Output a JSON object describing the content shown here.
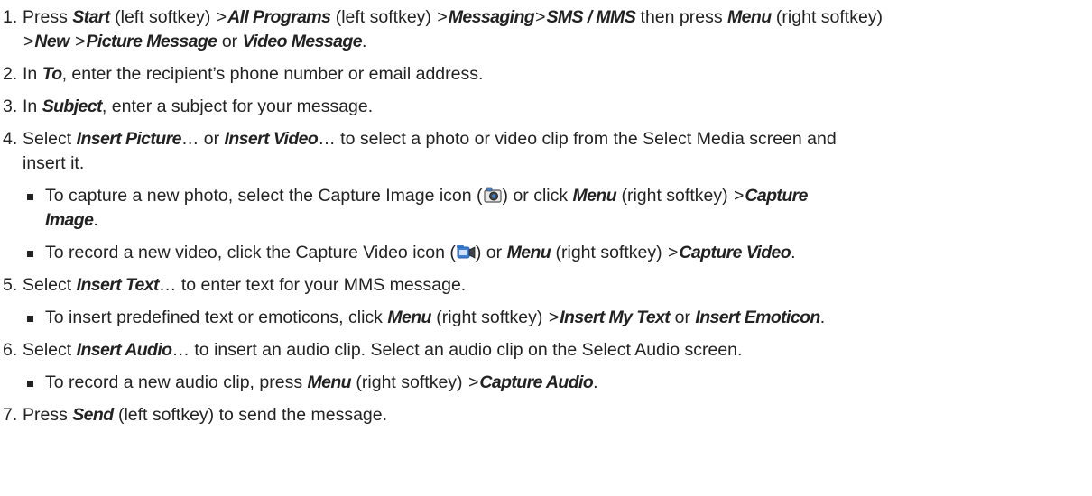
{
  "steps": [
    {
      "num": "1.",
      "parts": [
        {
          "t": "Press "
        },
        {
          "b": "Start"
        },
        {
          "t": " (left softkey) "
        },
        {
          "gt": true
        },
        {
          "b": "All Programs"
        },
        {
          "t": " (left softkey) "
        },
        {
          "gt": true
        },
        {
          "b": "Messaging"
        },
        {
          "gt": true
        },
        {
          "b": "SMS / MMS"
        },
        {
          "t": " then press "
        },
        {
          "b": "Menu"
        },
        {
          "t": " (right softkey)"
        },
        {
          "br": true
        },
        {
          "gt": true
        },
        {
          "b": "New"
        },
        {
          "t": " "
        },
        {
          "gt": true
        },
        {
          "b": "Picture Message"
        },
        {
          "t": " or "
        },
        {
          "b": "Video Message"
        },
        {
          "t": "."
        }
      ]
    },
    {
      "num": "2.",
      "parts": [
        {
          "t": "In "
        },
        {
          "b": "To"
        },
        {
          "t": ", enter the recipient’s phone number or email address."
        }
      ]
    },
    {
      "num": "3.",
      "parts": [
        {
          "t": "In "
        },
        {
          "b": "Subject"
        },
        {
          "t": ", enter a subject for your message."
        }
      ]
    },
    {
      "num": "4.",
      "parts": [
        {
          "t": "Select "
        },
        {
          "b": "Insert Picture"
        },
        {
          "t": "… or "
        },
        {
          "b": "Insert Video"
        },
        {
          "t": "… to select a photo or video clip from the Select Media screen and"
        },
        {
          "br": true
        },
        {
          "t": "insert it."
        }
      ],
      "bullets": [
        {
          "parts": [
            {
              "t": "To capture a new photo, select the Capture Image icon ("
            },
            {
              "icon": "camera-icon"
            },
            {
              "t": ") or click "
            },
            {
              "b": "Menu"
            },
            {
              "t": " (right softkey) "
            },
            {
              "gt": true
            },
            {
              "b": "Capture"
            },
            {
              "br": true
            },
            {
              "b": "Image"
            },
            {
              "t": "."
            }
          ]
        },
        {
          "parts": [
            {
              "t": "To record a new video, click the Capture Video icon ("
            },
            {
              "icon": "video-camera-icon"
            },
            {
              "t": ") or "
            },
            {
              "b": "Menu"
            },
            {
              "t": " (right softkey) "
            },
            {
              "gt": true
            },
            {
              "b": "Capture Video"
            },
            {
              "t": "."
            }
          ]
        }
      ]
    },
    {
      "num": "5.",
      "parts": [
        {
          "t": "Select "
        },
        {
          "b": "Insert Text"
        },
        {
          "t": "… to enter text for your MMS message."
        }
      ],
      "bullets": [
        {
          "parts": [
            {
              "t": "To insert predefined text or emoticons, click "
            },
            {
              "b": "Menu"
            },
            {
              "t": " (right softkey) "
            },
            {
              "gt": true
            },
            {
              "b": "Insert My Text"
            },
            {
              "t": " or "
            },
            {
              "b": "Insert Emoticon"
            },
            {
              "t": "."
            }
          ]
        }
      ]
    },
    {
      "num": "6.",
      "parts": [
        {
          "t": "Select "
        },
        {
          "b": "Insert Audio"
        },
        {
          "t": "… to insert an audio clip. Select an audio clip on the Select Audio screen."
        }
      ],
      "bullets": [
        {
          "parts": [
            {
              "t": "To record a new audio clip, press "
            },
            {
              "b": "Menu"
            },
            {
              "t": " (right softkey) "
            },
            {
              "gt": true
            },
            {
              "b": "Capture Audio"
            },
            {
              "t": "."
            }
          ]
        }
      ]
    },
    {
      "num": "7.",
      "parts": [
        {
          "t": "Press "
        },
        {
          "b": "Send"
        },
        {
          "t": " (left softkey) to send the message."
        }
      ]
    }
  ],
  "gt_glyph": ">",
  "colors": {
    "text": "#222222",
    "icon_blue": "#3a7fd5"
  }
}
